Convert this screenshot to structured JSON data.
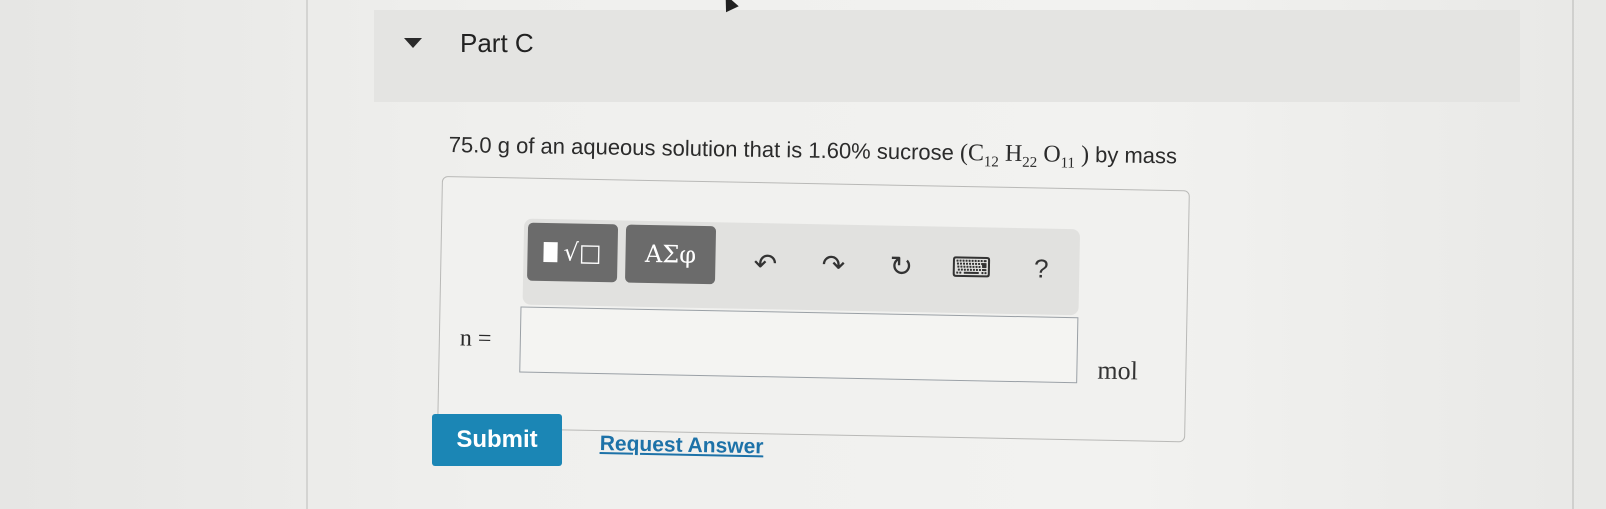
{
  "part": {
    "title": "Part C"
  },
  "question": {
    "text_before": "75.0 g of an aqueous solution that is 1.60% sucrose",
    "formula": {
      "open": "(",
      "c": "C",
      "c_sub": "12",
      "h": "H",
      "h_sub": "22",
      "o": "O",
      "o_sub": "11",
      "close": ")"
    },
    "text_after": "by mass"
  },
  "toolbar": {
    "templates_label": "√□",
    "greek_label": "ΑΣφ",
    "undo_glyph": "↶",
    "redo_glyph": "↷",
    "reset_glyph": "↻",
    "keyboard_glyph": "⌨",
    "help_label": "?"
  },
  "answer": {
    "variable_label": "n =",
    "value": "",
    "unit": "mol"
  },
  "actions": {
    "submit_label": "Submit",
    "request_answer_label": "Request Answer"
  },
  "colors": {
    "submit_bg": "#1b86b5",
    "link": "#1d72a8",
    "toolbar_dark": "#6b6b6b"
  }
}
